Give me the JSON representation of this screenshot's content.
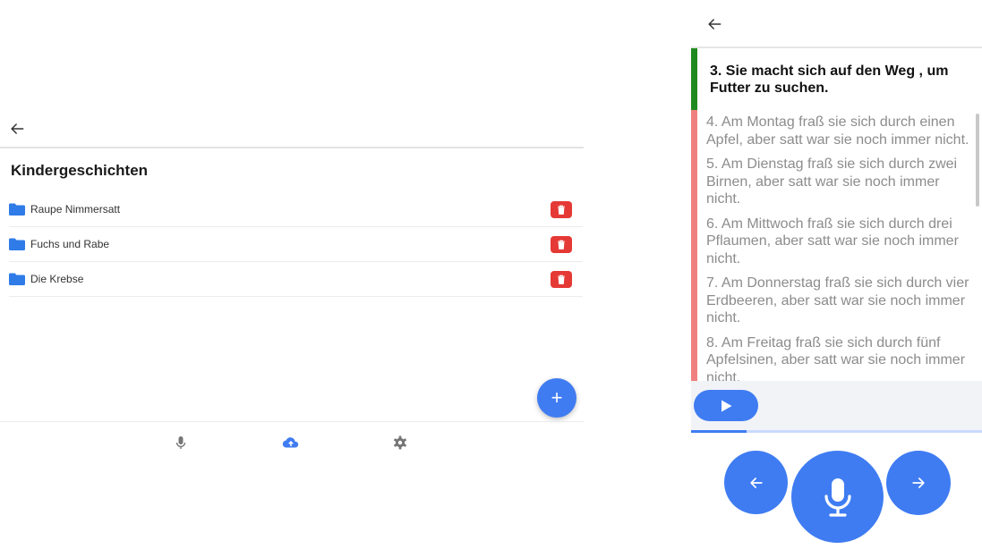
{
  "left_screen": {
    "title": "Kindergeschichten",
    "icons": {
      "back": "arrow-left-icon",
      "folder": "folder-icon",
      "delete": "trash-icon",
      "add": "plus-icon"
    },
    "add_button_label": "+",
    "folders": [
      {
        "name": "Raupe Nimmersatt"
      },
      {
        "name": "Fuchs und Rabe"
      },
      {
        "name": "Die Krebse"
      }
    ],
    "bottom_nav": [
      {
        "icon": "microphone-icon",
        "active": false
      },
      {
        "icon": "cloud-upload-icon",
        "active": true
      },
      {
        "icon": "gear-icon",
        "active": false
      }
    ],
    "colors": {
      "accent": "#3f7cf2",
      "folder": "#2f7be8",
      "delete": "#e53935",
      "inactive_icon": "#757575"
    }
  },
  "right_screen": {
    "icons": {
      "back": "arrow-left-icon",
      "play": "play-icon",
      "prev": "arrow-left-icon",
      "mic": "microphone-icon",
      "next": "arrow-right-icon"
    },
    "current_sentence": "3. Sie macht sich auf den Weg , um Futter zu suchen.",
    "sentences": [
      "4. Am Montag fraß sie sich durch einen Apfel, aber satt war sie noch immer nicht.",
      "5. Am Dienstag fraß sie sich durch zwei Birnen, aber satt war sie noch immer nicht.",
      "6. Am Mittwoch fraß sie sich durch drei Pflaumen, aber satt war sie noch immer nicht.",
      "7. Am Donnerstag fraß sie sich durch vier Erdbeeren, aber satt war sie noch immer nicht.",
      "8. Am Freitag fraß sie sich durch fünf Apfelsinen, aber satt war sie noch immer nicht."
    ],
    "playback_progress_percent": 19,
    "colors": {
      "current_marker": "#1f8a1f",
      "pending_marker": "#f08080",
      "accent": "#3f7cf2"
    }
  }
}
